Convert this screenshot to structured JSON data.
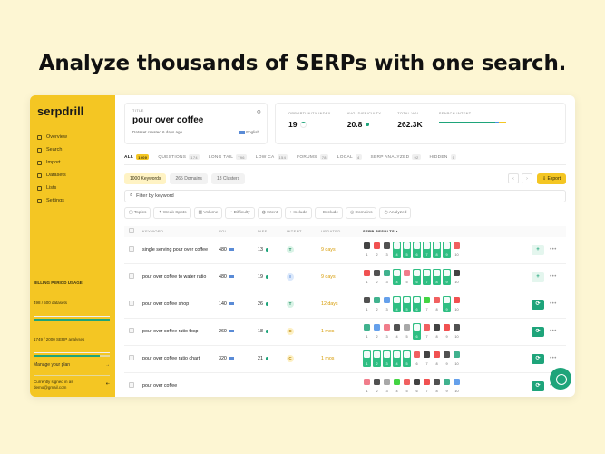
{
  "headline": "Analyze thousands of SERPs with one search.",
  "sidebar": {
    "logo": "serpdrill",
    "items": [
      {
        "label": "Overview",
        "icon": "home-icon"
      },
      {
        "label": "Search",
        "icon": "search-icon"
      },
      {
        "label": "Import",
        "icon": "import-icon"
      },
      {
        "label": "Datasets",
        "icon": "database-icon"
      },
      {
        "label": "Lists",
        "icon": "list-icon"
      },
      {
        "label": "Settings",
        "icon": "gear-icon"
      }
    ],
    "usage": {
      "title": "BILLING PERIOD USAGE",
      "datasets": "498 / 500 datasets",
      "datasets_fraction": 0.996,
      "serp": "1749 / 2000 SERP analyses",
      "serp_fraction": 0.8745,
      "manage": "Manage your plan",
      "signed_in_label": "Currently signed in as",
      "email": "demo@gmail.com"
    }
  },
  "title_card": {
    "label": "TITLE",
    "value": "pour over coffee",
    "created": "Dataset created 6 days ago",
    "language": "English"
  },
  "metrics": [
    {
      "label": "OPPORTUNITY INDEX",
      "value": "19"
    },
    {
      "label": "AVG. DIFFICULTY",
      "value": "20.8"
    },
    {
      "label": "TOTAL VOL.",
      "value": "262.3K"
    },
    {
      "label": "SEARCH INTENT",
      "value": ""
    }
  ],
  "tabs": [
    {
      "label": "ALL",
      "count": "1000",
      "active": true
    },
    {
      "label": "QUESTIONS",
      "count": "174"
    },
    {
      "label": "LONG TAIL",
      "count": "796"
    },
    {
      "label": "LOW CA",
      "count": "154"
    },
    {
      "label": "FORUMS",
      "count": "78"
    },
    {
      "label": "LOCAL",
      "count": "4"
    },
    {
      "label": "SERP ANALYZED",
      "count": "92"
    },
    {
      "label": "HIDDEN",
      "count": "0"
    }
  ],
  "chips": [
    "1000 Keywords",
    "265 Domains",
    "18 Clusters"
  ],
  "export_label": "Export",
  "filter_placeholder": "Filter by keyword",
  "filters": [
    "Topics",
    "Weak Spots",
    "Volume",
    "Difficulty",
    "Intent",
    "Include",
    "Exclude",
    "Domains",
    "Analyzed"
  ],
  "table": {
    "headers": [
      "KEYWORD",
      "VOL.",
      "DIFF.",
      "INTENT",
      "UPDATED",
      "SERP RESULTS"
    ],
    "rows": [
      {
        "keyword": "single serving pour over coffee",
        "vol": "480",
        "diff": "13",
        "intent": "T",
        "updated": "9 days",
        "action": "add",
        "tiles": [
          "1",
          "2",
          "3",
          "4",
          "5",
          "6",
          "7",
          "8",
          "9",
          "10"
        ]
      },
      {
        "keyword": "pour over coffee to water ratio",
        "vol": "480",
        "diff": "19",
        "intent": "I",
        "updated": "9 days",
        "action": "add",
        "tiles": [
          "1",
          "2",
          "3",
          "4",
          "5",
          "6",
          "7",
          "8",
          "9",
          "10"
        ]
      },
      {
        "keyword": "pour over coffee shop",
        "vol": "140",
        "diff": "26",
        "intent": "T",
        "updated": "12 days",
        "action": "refresh",
        "tiles": [
          "1",
          "2",
          "3",
          "4",
          "5",
          "6",
          "7",
          "8",
          "9",
          "10"
        ]
      },
      {
        "keyword": "pour over coffee ratio tbsp",
        "vol": "260",
        "diff": "18",
        "intent": "C",
        "updated": "1 mos",
        "action": "refresh",
        "tiles": [
          "1",
          "2",
          "3",
          "4",
          "5",
          "6",
          "7",
          "8",
          "9",
          "10"
        ]
      },
      {
        "keyword": "pour over coffee ratio chart",
        "vol": "320",
        "diff": "21",
        "intent": "C",
        "updated": "1 mos",
        "action": "refresh",
        "tiles": [
          "1",
          "2",
          "3",
          "4",
          "5",
          "6",
          "7",
          "8",
          "9",
          "10"
        ]
      },
      {
        "keyword": "pour over coffee",
        "vol": "",
        "diff": "",
        "intent": "",
        "updated": "",
        "action": "refresh",
        "tiles": [
          "1",
          "2",
          "3",
          "4",
          "5",
          "6",
          "7",
          "8",
          "9",
          "10"
        ]
      }
    ]
  },
  "colors": {
    "brand": "#f4c623",
    "green": "#1ea47a",
    "amber": "#d69a00"
  }
}
